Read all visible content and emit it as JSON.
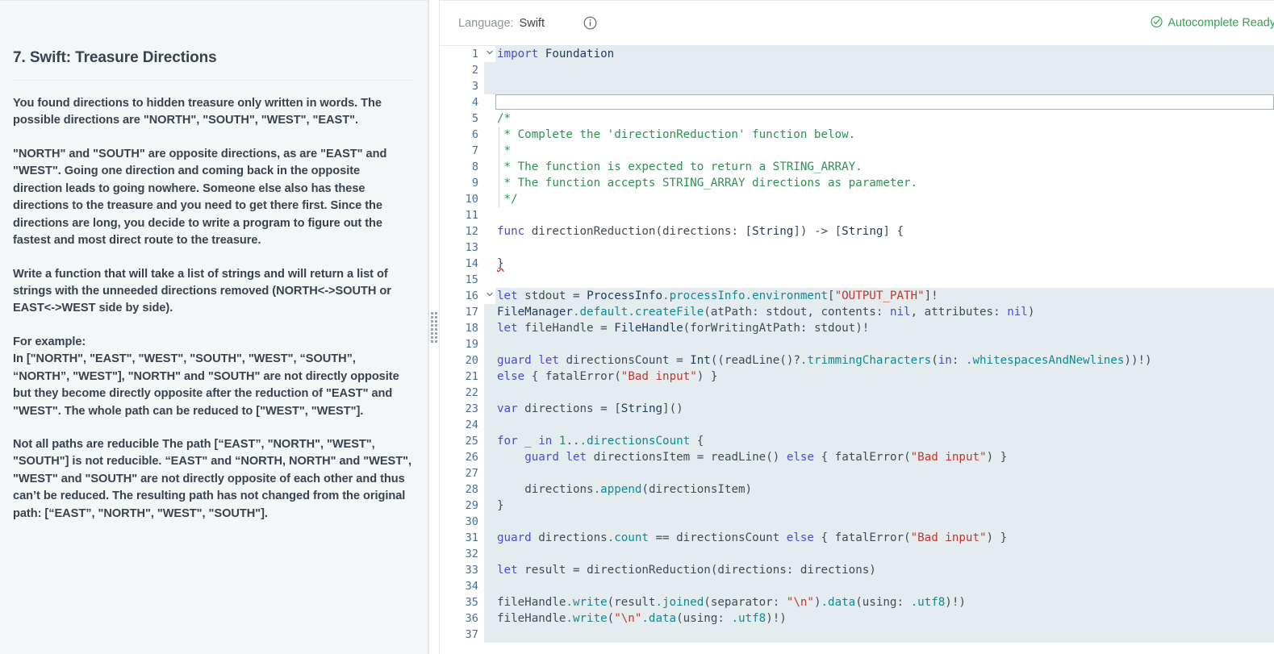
{
  "problem": {
    "title": "7. Swift: Treasure Directions",
    "paragraphs": [
      "You found directions to hidden treasure only written in words. The possible directions are \"NORTH\", \"SOUTH\", \"WEST\", \"EAST\".",
      "\"NORTH\" and \"SOUTH\" are opposite directions, as are \"EAST\" and \"WEST\". Going one direction and coming back in the opposite direction leads to going nowhere. Someone else also has these directions to the treasure and you need to get there first. Since the directions are long, you decide to write a program to figure out the fastest and most direct route to the treasure.",
      "Write a function that will take a list of strings and will return a list of strings with the unneeded directions removed (NORTH<->SOUTH or EAST<->WEST side by side).",
      "For example:\nIn [\"NORTH\", \"EAST\", \"WEST\", \"SOUTH\", \"WEST\", “SOUTH”, “NORTH”, \"WEST\"], \"NORTH\" and \"SOUTH\" are not directly opposite but they become directly opposite after the reduction of \"EAST\" and \"WEST\". The whole path can be reduced to [\"WEST\", \"WEST\"].",
      "Not all paths are reducible The path [“EAST”, \"NORTH\", \"WEST\", \"SOUTH\"] is not reducible. “EAST\" and “NORTH, NORTH\" and \"WEST\", \"WEST\" and \"SOUTH\" are not directly opposite of each other and thus can’t be reduced. The resulting path has not changed from the original path: [“EAST”, \"NORTH\", \"WEST\", \"SOUTH\"]."
    ]
  },
  "editor": {
    "language_label": "Language:",
    "language_value": "Swift",
    "info_icon": "info-circle-icon",
    "autocomplete_status": "Autocomplete Ready",
    "autocomplete_icon": "check-circle-icon",
    "accent_green": "#2ea44f",
    "readonly_bg": "#e4ecf0",
    "line_numbers": [
      1,
      2,
      3,
      4,
      5,
      6,
      7,
      8,
      9,
      10,
      11,
      12,
      13,
      14,
      15,
      16,
      17,
      18,
      19,
      20,
      21,
      22,
      23,
      24,
      25,
      26,
      27,
      28,
      29,
      30,
      31,
      32,
      33,
      34,
      35,
      36,
      37
    ],
    "lines": [
      {
        "n": 1,
        "readonly": true,
        "fold": "v",
        "text": "import Foundation"
      },
      {
        "n": 2,
        "readonly": true,
        "fold": "",
        "text": ""
      },
      {
        "n": 3,
        "readonly": true,
        "fold": "",
        "text": ""
      },
      {
        "n": 4,
        "readonly": false,
        "fold": "",
        "text": "",
        "editable": true
      },
      {
        "n": 5,
        "readonly": false,
        "fold": "",
        "text": "/*"
      },
      {
        "n": 6,
        "readonly": false,
        "fold": "",
        "text": " * Complete the 'directionReduction' function below."
      },
      {
        "n": 7,
        "readonly": false,
        "fold": "",
        "text": " *"
      },
      {
        "n": 8,
        "readonly": false,
        "fold": "",
        "text": " * The function is expected to return a STRING_ARRAY."
      },
      {
        "n": 9,
        "readonly": false,
        "fold": "",
        "text": " * The function accepts STRING_ARRAY directions as parameter."
      },
      {
        "n": 10,
        "readonly": false,
        "fold": "",
        "text": " */"
      },
      {
        "n": 11,
        "readonly": false,
        "fold": "",
        "text": ""
      },
      {
        "n": 12,
        "readonly": false,
        "fold": "",
        "text": "func directionReduction(directions: [String]) -> [String] {"
      },
      {
        "n": 13,
        "readonly": false,
        "fold": "",
        "text": ""
      },
      {
        "n": 14,
        "readonly": false,
        "fold": "",
        "text": "}"
      },
      {
        "n": 15,
        "readonly": false,
        "fold": "",
        "text": ""
      },
      {
        "n": 16,
        "readonly": true,
        "fold": "v",
        "text": "let stdout = ProcessInfo.processInfo.environment[\"OUTPUT_PATH\"]!"
      },
      {
        "n": 17,
        "readonly": true,
        "fold": "",
        "text": "FileManager.default.createFile(atPath: stdout, contents: nil, attributes: nil)"
      },
      {
        "n": 18,
        "readonly": true,
        "fold": "",
        "text": "let fileHandle = FileHandle(forWritingAtPath: stdout)!"
      },
      {
        "n": 19,
        "readonly": true,
        "fold": "",
        "text": ""
      },
      {
        "n": 20,
        "readonly": true,
        "fold": "",
        "text": "guard let directionsCount = Int((readLine()?.trimmingCharacters(in: .whitespacesAndNewlines))!)"
      },
      {
        "n": 21,
        "readonly": true,
        "fold": "",
        "text": "else { fatalError(\"Bad input\") }"
      },
      {
        "n": 22,
        "readonly": true,
        "fold": "",
        "text": ""
      },
      {
        "n": 23,
        "readonly": true,
        "fold": "",
        "text": "var directions = [String]()"
      },
      {
        "n": 24,
        "readonly": true,
        "fold": "",
        "text": ""
      },
      {
        "n": 25,
        "readonly": true,
        "fold": "",
        "text": "for _ in 1...directionsCount {"
      },
      {
        "n": 26,
        "readonly": true,
        "fold": "",
        "text": "    guard let directionsItem = readLine() else { fatalError(\"Bad input\") }"
      },
      {
        "n": 27,
        "readonly": true,
        "fold": "",
        "text": ""
      },
      {
        "n": 28,
        "readonly": true,
        "fold": "",
        "text": "    directions.append(directionsItem)"
      },
      {
        "n": 29,
        "readonly": true,
        "fold": "",
        "text": "}"
      },
      {
        "n": 30,
        "readonly": true,
        "fold": "",
        "text": ""
      },
      {
        "n": 31,
        "readonly": true,
        "fold": "",
        "text": "guard directions.count == directionsCount else { fatalError(\"Bad input\") }"
      },
      {
        "n": 32,
        "readonly": true,
        "fold": "",
        "text": ""
      },
      {
        "n": 33,
        "readonly": true,
        "fold": "",
        "text": "let result = directionReduction(directions: directions)"
      },
      {
        "n": 34,
        "readonly": true,
        "fold": "",
        "text": ""
      },
      {
        "n": 35,
        "readonly": true,
        "fold": "",
        "text": "fileHandle.write(result.joined(separator: \"\\n\").data(using: .utf8)!)"
      },
      {
        "n": 36,
        "readonly": true,
        "fold": "",
        "text": "fileHandle.write(\"\\n\".data(using: .utf8)!)"
      },
      {
        "n": 37,
        "readonly": true,
        "fold": "",
        "text": ""
      }
    ]
  },
  "splitter": {
    "name": "pane-resize-handle"
  }
}
